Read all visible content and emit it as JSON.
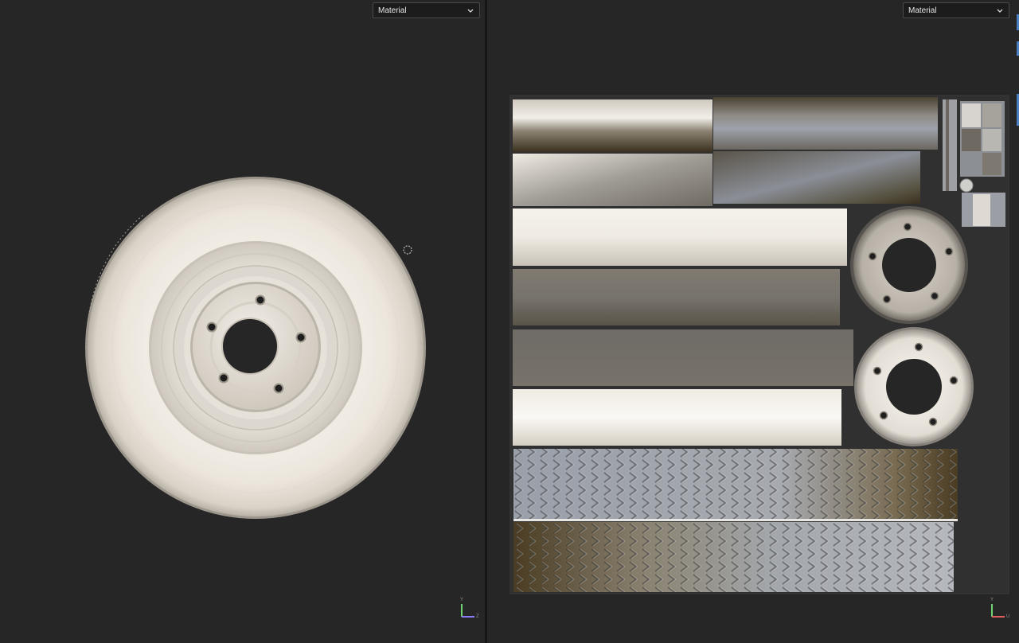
{
  "left_viewport": {
    "material_dropdown": {
      "selected": "Material"
    },
    "axis": {
      "y": "Y",
      "z": "Z"
    }
  },
  "right_viewport": {
    "material_dropdown": {
      "selected": "Material"
    },
    "axis": {
      "y": "Y",
      "u": "U"
    }
  }
}
